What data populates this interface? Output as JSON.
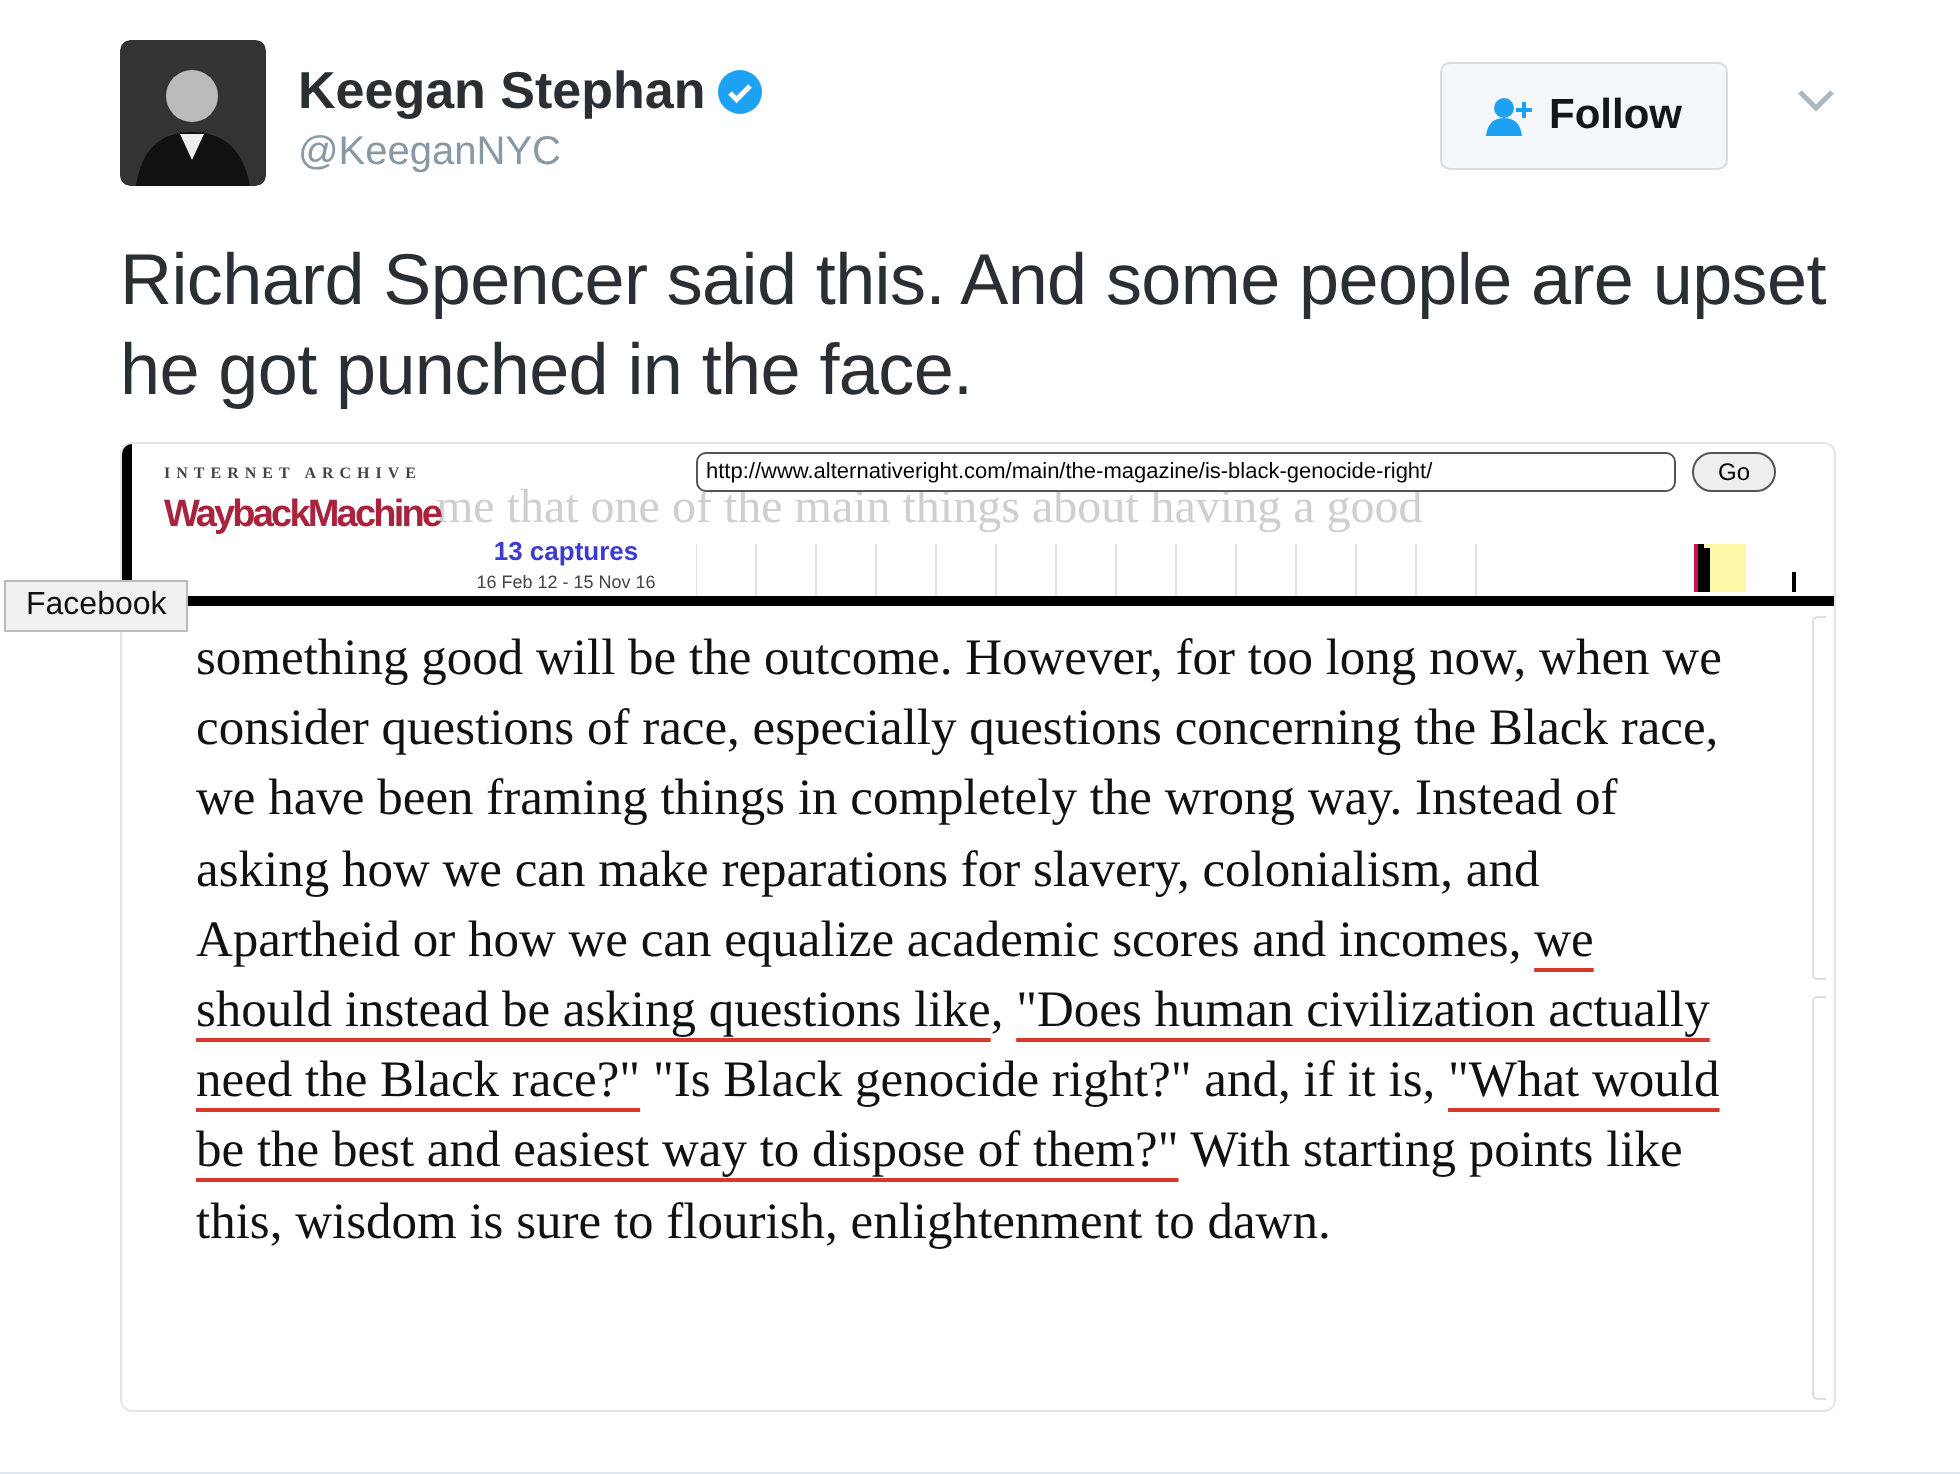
{
  "author": {
    "name": "Keegan Stephan",
    "verified": true,
    "handle": "@KeeganNYC"
  },
  "follow_button": {
    "label": "Follow"
  },
  "tweet_text": "Richard Spencer said this. And some people are upset he got punched in the face.",
  "screenshot": {
    "wayback": {
      "brand_top": "INTERNET ARCHIVE",
      "brand": "WaybackMachine",
      "url": "http://www.alternativeright.com/main/the-magazine/is-black-genocide-right/",
      "go": "Go",
      "captures": "13 captures",
      "date_range": "16 Feb 12 - 15 Nov 16"
    },
    "ghost_lines": [
      "me that one of the main things about having a good"
    ],
    "segments": [
      {
        "text": "something good will be the outcome. However, for too long now, when we consider questions of race, especially questions concerning the Black race, we have been framing things in completely the wrong way. Instead of asking how we can make reparations for slavery, colonialism, and Apartheid or how we can equalize academic scores and incomes, ",
        "underlined": false
      },
      {
        "text": "we should instead be asking questions like",
        "underlined": true
      },
      {
        "text": ", ",
        "underlined": false
      },
      {
        "text": "\"Does human civilization actually need the Black race?\"",
        "underlined": true
      },
      {
        "text": " \"Is Black genocide right?\" and, if it is, ",
        "underlined": false
      },
      {
        "text": "\"What would be the best and easiest way to dispose of them?\"",
        "underlined": true
      },
      {
        "text": " With starting points like this, wisdom is sure to flourish, enlightenment to dawn.",
        "underlined": false
      }
    ]
  },
  "tooltip": "Facebook"
}
